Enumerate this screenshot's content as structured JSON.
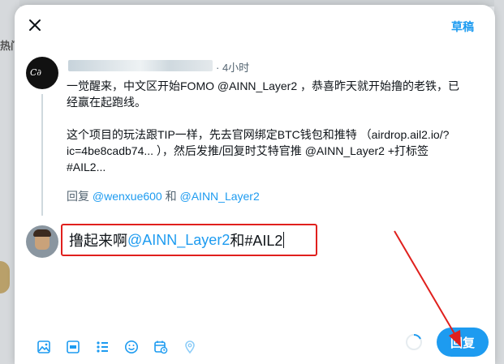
{
  "background": {
    "hot_tab_label": "热门"
  },
  "header": {
    "drafts_label": "草稿",
    "close_icon": "close-icon"
  },
  "original_post": {
    "time": "· 4小时",
    "lines": [
      "一觉醒来，中文区开始FOMO @AINN_Layer2 ，恭喜昨天就开始撸的老铁，已",
      "经赢在起跑线。",
      "这个项目的玩法跟TIP一样，先去官网绑定BTC钱包和推特 （airdrop.ail2.io/?",
      "ic=4be8cadb74... ），然后发推/回复时艾特官推 @AINN_Layer2 +打标签",
      "#AIL2..."
    ],
    "reply_to_prefix": "回复 ",
    "reply_to_user1": "@wenxue600",
    "reply_to_and": " 和 ",
    "reply_to_user2": "@AINN_Layer2"
  },
  "compose": {
    "text_before": "撸起来啊",
    "mention": "@AINN_Layer2",
    "text_after": " 和#AIL2"
  },
  "toolbar": {
    "icons": [
      "image-icon",
      "gif-icon",
      "poll-icon",
      "emoji-icon",
      "schedule-icon",
      "location-icon"
    ]
  },
  "reply_button": {
    "label": "回复"
  },
  "colors": {
    "accent": "#1d9bf0",
    "highlight_border": "#e0201d",
    "text": "#0f1419",
    "secondary": "#536471"
  }
}
